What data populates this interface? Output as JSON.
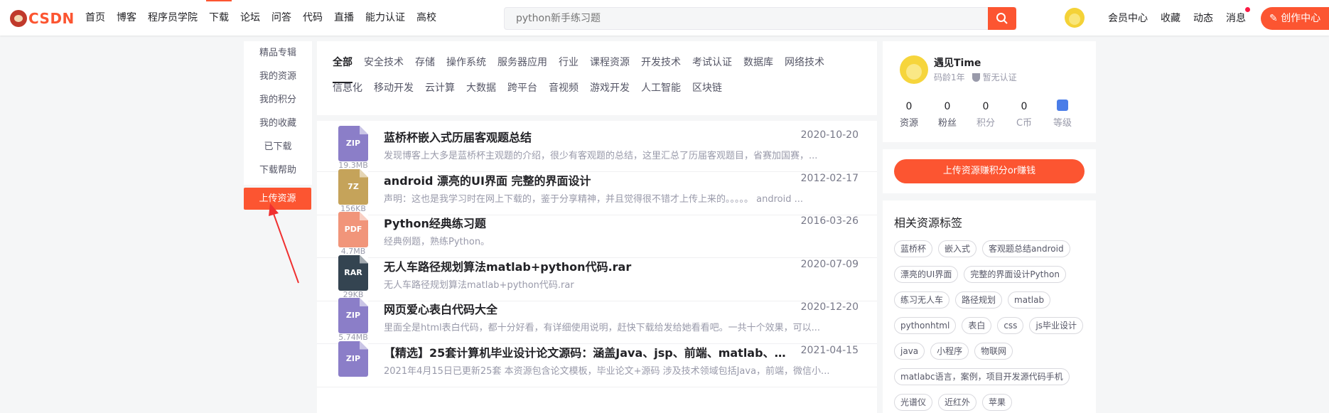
{
  "topbar": {
    "logo_text": "CSDN",
    "nav": [
      "首页",
      "博客",
      "程序员学院",
      "下载",
      "论坛",
      "问答",
      "代码",
      "直播",
      "能力认证",
      "高校"
    ],
    "active_nav": "下载",
    "search": {
      "placeholder": "python新手练习题"
    },
    "right_nav": [
      "会员中心",
      "收藏",
      "动态",
      "消息"
    ],
    "create_label": "创作中心"
  },
  "left_menu": {
    "items": [
      "精品专辑",
      "我的资源",
      "我的积分",
      "我的收藏",
      "已下载",
      "下载帮助"
    ],
    "upload_label": "上传资源"
  },
  "categories": {
    "row1": [
      "全部",
      "安全技术",
      "存储",
      "操作系统",
      "服务器应用",
      "行业",
      "课程资源",
      "开发技术",
      "考试认证",
      "数据库",
      "网络技术"
    ],
    "row2": [
      "信息化",
      "移动开发",
      "云计算",
      "大数据",
      "跨平台",
      "音视频",
      "游戏开发",
      "人工智能",
      "区块链"
    ],
    "active": "全部"
  },
  "resources": [
    {
      "type": "ZIP",
      "color": "#8b7ec8",
      "size": "19.3MB",
      "title": "蓝桥杯嵌入式历届客观题总结",
      "date": "2020-10-20",
      "desc": "发现博客上大多是蓝桥杯主观题的介绍，很少有客观题的总结，这里汇总了历届客观题目，省赛加国赛，..."
    },
    {
      "type": "7Z",
      "color": "#c5a35a",
      "size": "156KB",
      "title": "android 漂亮的UI界面 完整的界面设计",
      "date": "2012-02-17",
      "desc": "声明：这也是我学习时在网上下载的，鉴于分享精神，并且觉得很不错才上传上来的。。。。。 android ..."
    },
    {
      "type": "PDF",
      "color": "#f1957a",
      "size": "4.7MB",
      "title": "Python经典练习题",
      "date": "2016-03-26",
      "desc": "经典例题，熟练Python。"
    },
    {
      "type": "RAR",
      "color": "#344451",
      "size": "29KB",
      "title": "无人车路径规划算法matlab+python代码.rar",
      "date": "2020-07-09",
      "desc": "无人车路径规划算法matlab+python代码.rar"
    },
    {
      "type": "ZIP",
      "color": "#8b7ec8",
      "size": "5.74MB",
      "title": "网页爱心表白代码大全",
      "date": "2020-12-20",
      "desc": "里面全是html表白代码，都十分好看，有详细使用说明，赶快下载给发给她看看吧。一共十个效果，可以..."
    },
    {
      "type": "ZIP",
      "color": "#8b7ec8",
      "size": "",
      "title": "【精选】25套计算机毕业设计论文源码：涵盖Java、jsp、前端、matlab、小...",
      "date": "2021-04-15",
      "desc": "2021年4月15日已更新25套 本资源包含论文模板，毕业论文+源码 涉及技术领域包括Java，前端，微信小..."
    }
  ],
  "profile": {
    "name": "遇见Time",
    "age": "码龄1年",
    "cert": "暂无认证",
    "stats": [
      {
        "value": "0",
        "label": "资源"
      },
      {
        "value": "0",
        "label": "粉丝"
      },
      {
        "value": "0",
        "label": "积分"
      },
      {
        "value": "0",
        "label": "C币"
      },
      {
        "value": "",
        "label": "等级"
      }
    ]
  },
  "upload_card": {
    "label": "上传资源赚积分or赚钱"
  },
  "tags": {
    "title": "相关资源标签",
    "items": [
      "蓝桥杯",
      "嵌入式",
      "客观题总结android",
      "漂亮的UI界面",
      "完整的界面设计Python",
      "练习无人车",
      "路径规划",
      "matlab",
      "pythonhtml",
      "表白",
      "css",
      "js毕业设计",
      "java",
      "小程序",
      "物联网",
      "matlabc语言，案例，项目开发源代码手机",
      "光谱仪",
      "近红外",
      "苹果"
    ]
  },
  "colors": {
    "accent": "#fc5531",
    "annotation_arrow": "#f03030"
  }
}
